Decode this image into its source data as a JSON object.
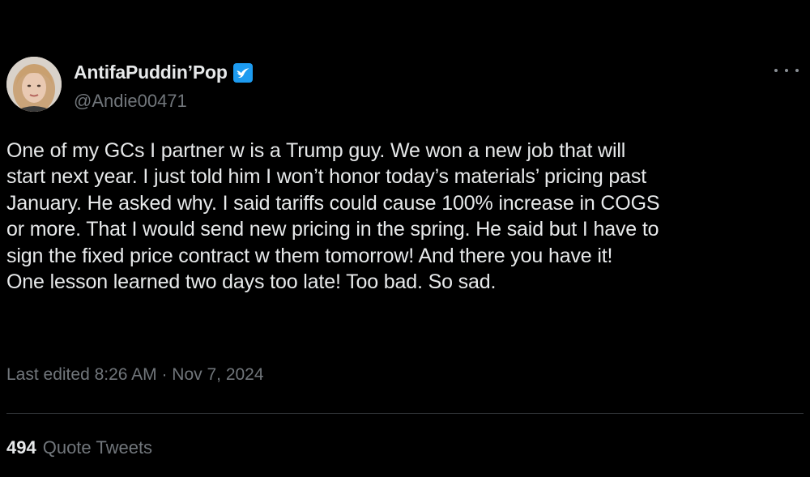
{
  "tweet": {
    "display_name": "AntifaPuddin’Pop",
    "handle": "@Andie00471",
    "text": "One of my GCs I partner w is a Trump guy. We won a new job that will\nstart next year. I just told him I won’t honor today’s materials’ pricing past\nJanuary. He asked why. I said tariffs could cause 100% increase in COGS\nor more. That I would send new pricing in the spring. He said but I have to\nsign the fixed price contract w them tomorrow! And there you have it!\nOne lesson learned two days too late! Too bad. So sad.",
    "timestamp": "Last edited 8:26 AM · Nov 7, 2024",
    "quote_count": "494",
    "quote_label": "Quote Tweets"
  },
  "icons": {
    "verified": "verified-badge-icon",
    "more": "more-options-icon",
    "avatar": "profile-avatar"
  },
  "colors": {
    "background": "#000000",
    "text_primary": "#e7e9ea",
    "text_secondary": "#71767b",
    "verified_blue": "#1d9bf0",
    "divider": "#2f3336"
  }
}
